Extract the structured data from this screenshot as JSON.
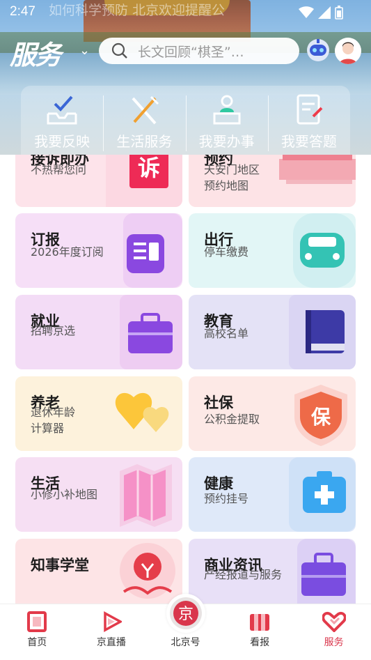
{
  "status_bar": {
    "time": "2:47",
    "faded_text": "如何科学预防  北京欢迎提醒公"
  },
  "header": {
    "logo_text": "服务",
    "search_placeholder": "长文回顾“棋圣”…"
  },
  "quick_actions": [
    {
      "label": "我要反映",
      "icon": "inbox-check-icon"
    },
    {
      "label": "生活服务",
      "icon": "fork-knife-icon"
    },
    {
      "label": "我要办事",
      "icon": "service-desk-icon"
    },
    {
      "label": "我要答题",
      "icon": "quiz-doc-icon"
    }
  ],
  "cards": [
    {
      "title": "接诉即办",
      "sub1": "不热帮您问",
      "sub2": "",
      "icon": "complaint-icon",
      "bg": "#fde3ea"
    },
    {
      "title": "预约",
      "sub1": "天安门地区",
      "sub2": "预约地图",
      "icon": "tiananmen-icon",
      "bg": "#fde3e6"
    },
    {
      "title": "订报",
      "sub1": "2026年度订阅",
      "sub2": "",
      "icon": "newspaper-icon",
      "bg": "#f6dff7"
    },
    {
      "title": "出行",
      "sub1": "停车缴费",
      "sub2": "",
      "icon": "car-icon",
      "bg": "#e2f6f6"
    },
    {
      "title": "就业",
      "sub1": "招聘京选",
      "sub2": "",
      "icon": "briefcase-icon",
      "bg": "#f3dcf6"
    },
    {
      "title": "教育",
      "sub1": "高校名单",
      "sub2": "",
      "icon": "book-icon",
      "bg": "#e4e2f6"
    },
    {
      "title": "养老",
      "sub1": "退休年龄",
      "sub2": "计算器",
      "icon": "hearts-icon",
      "bg": "#fdf2dc"
    },
    {
      "title": "社保",
      "sub1": "公积金提取",
      "sub2": "",
      "icon": "shield-bao-icon",
      "bg": "#fde9e6"
    },
    {
      "title": "生活",
      "sub1": "小修小补地图",
      "sub2": "",
      "icon": "map-icon",
      "bg": "#f6dff3"
    },
    {
      "title": "健康",
      "sub1": "预约挂号",
      "sub2": "",
      "icon": "medical-kit-icon",
      "bg": "#dfe9f9"
    },
    {
      "title": "知事学堂",
      "sub1": "",
      "sub2": "",
      "icon": "lightbulb-book-icon",
      "bg": "#fde4e6"
    },
    {
      "title": "商业资讯",
      "sub1": "产经报道与服务",
      "sub2": "",
      "icon": "briefcase-icon",
      "bg": "#e8e0f7"
    }
  ],
  "bottom_nav": [
    {
      "label": "首页",
      "icon": "home-icon",
      "active": false
    },
    {
      "label": "京直播",
      "icon": "play-icon",
      "active": false
    },
    {
      "label": "北京号",
      "icon": "beijing-badge-icon",
      "active": false
    },
    {
      "label": "看报",
      "icon": "newspaper-icon",
      "active": false
    },
    {
      "label": "服务",
      "icon": "heart-service-icon",
      "active": true
    }
  ],
  "colors": {
    "accent": "#d9364c",
    "purple": "#7a4de0",
    "teal": "#35c9b8",
    "orange": "#f08a4a",
    "blue": "#3aa7f0"
  }
}
